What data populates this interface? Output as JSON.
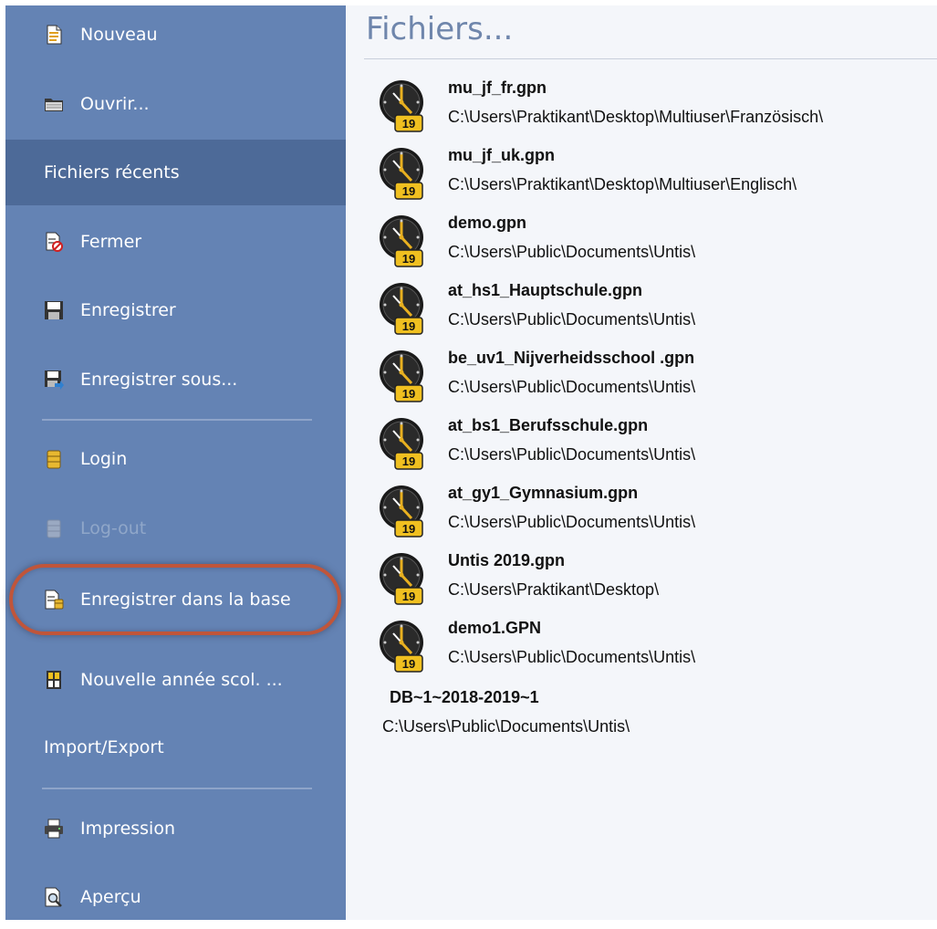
{
  "sidebar": {
    "items": [
      {
        "label": "Nouveau",
        "icon": "new-document-icon"
      },
      {
        "label": "Ouvrir...",
        "icon": "open-folder-icon"
      },
      {
        "label": "Fichiers récents",
        "selected": true
      },
      {
        "label": "Fermer",
        "icon": "close-file-icon"
      },
      {
        "label": "Enregistrer",
        "icon": "save-icon"
      },
      {
        "label": "Enregistrer sous...",
        "icon": "save-as-icon"
      },
      {
        "label": "Login",
        "icon": "database-icon"
      },
      {
        "label": "Log-out",
        "icon": "database-icon",
        "disabled": true
      },
      {
        "label": "Enregistrer dans la base",
        "icon": "save-to-database-icon",
        "highlighted": true
      },
      {
        "label": "Nouvelle année scol. ...",
        "icon": "new-school-year-icon"
      },
      {
        "label": "Import/Export"
      },
      {
        "label": "Impression",
        "icon": "printer-icon"
      },
      {
        "label": "Aperçu",
        "icon": "print-preview-icon"
      }
    ]
  },
  "main": {
    "title": "Fichiers...",
    "files": [
      {
        "name": "mu_jf_fr.gpn",
        "path": "C:\\Users\\Praktikant\\Desktop\\Multiuser\\Französisch\\",
        "icon": "untis-clock-icon",
        "badge": "19"
      },
      {
        "name": "mu_jf_uk.gpn",
        "path": "C:\\Users\\Praktikant\\Desktop\\Multiuser\\Englisch\\",
        "icon": "untis-clock-icon",
        "badge": "19"
      },
      {
        "name": "demo.gpn",
        "path": "C:\\Users\\Public\\Documents\\Untis\\",
        "icon": "untis-clock-icon",
        "badge": "19"
      },
      {
        "name": "at_hs1_Hauptschule.gpn",
        "path": "C:\\Users\\Public\\Documents\\Untis\\",
        "icon": "untis-clock-icon",
        "badge": "19"
      },
      {
        "name": "be_uv1_Nijverheidsschool .gpn",
        "path": "C:\\Users\\Public\\Documents\\Untis\\",
        "icon": "untis-clock-icon",
        "badge": "19"
      },
      {
        "name": "at_bs1_Berufsschule.gpn",
        "path": "C:\\Users\\Public\\Documents\\Untis\\",
        "icon": "untis-clock-icon",
        "badge": "19"
      },
      {
        "name": "at_gy1_Gymnasium.gpn",
        "path": "C:\\Users\\Public\\Documents\\Untis\\",
        "icon": "untis-clock-icon",
        "badge": "19"
      },
      {
        "name": "Untis 2019.gpn",
        "path": "C:\\Users\\Praktikant\\Desktop\\",
        "icon": "untis-clock-icon",
        "badge": "19"
      },
      {
        "name": "demo1.GPN",
        "path": "C:\\Users\\Public\\Documents\\Untis\\",
        "icon": "untis-clock-icon",
        "badge": "19"
      },
      {
        "name": "DB~1~2018-2019~1",
        "path": "C:\\Users\\Public\\Documents\\Untis\\"
      }
    ]
  },
  "colors": {
    "sidebar_bg": "#6483b4",
    "sidebar_selected": "#4d6a98",
    "highlight_ring": "#c0553a",
    "title_color": "#6f86ac"
  }
}
